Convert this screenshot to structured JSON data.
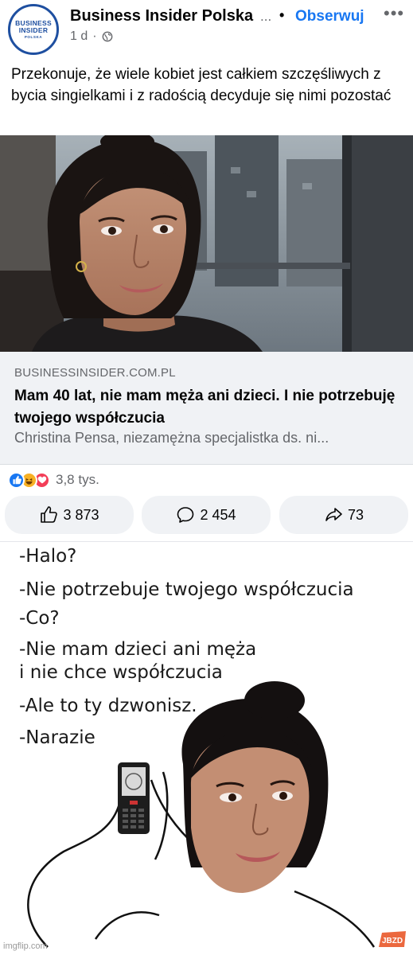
{
  "post": {
    "page_name": "Business Insider Polska",
    "name_truncation": "...",
    "separator": "•",
    "follow_label": "Obserwuj",
    "more_label": "•••",
    "time_ago": "1 d",
    "meta_dot": "·",
    "avatar": {
      "line1": "BUSINESS",
      "line2": "INSIDER",
      "line3": "POLSKA"
    },
    "caption": "Przekonuje, że wiele kobiet jest całkiem szczęśliwych z bycia singielkami i z radością decyduje się nimi pozostać"
  },
  "link_preview": {
    "domain": "BUSINESSINSIDER.COM.PL",
    "title": "Mam 40 lat, nie mam męża ani dzieci. I nie potrzebuję twojego współczucia",
    "description": "Christina Pensa, niezamężna specjalistka ds. ni..."
  },
  "reactions": {
    "types": [
      "like-icon",
      "haha-icon",
      "love-icon"
    ],
    "count": "3,8 tys."
  },
  "actions": {
    "like_count": "3 873",
    "comment_count": "2 454",
    "share_count": "73"
  },
  "meme": {
    "lines": [
      "-Halo?",
      "-Nie potrzebuje twojego współczucia",
      "-Co?",
      "-Nie mam dzieci ani męża",
      "i nie chce współczucia",
      "-Ale to ty dzwonisz.",
      "-Narazie"
    ],
    "watermark_imgflip": "imgflip.com",
    "watermark_jbzd": "JBZD"
  },
  "colors": {
    "accent": "#1877f2",
    "secondary_text": "#65676b",
    "button_bg": "#f0f2f5",
    "love": "#f33e58",
    "haha": "#f7b125"
  }
}
